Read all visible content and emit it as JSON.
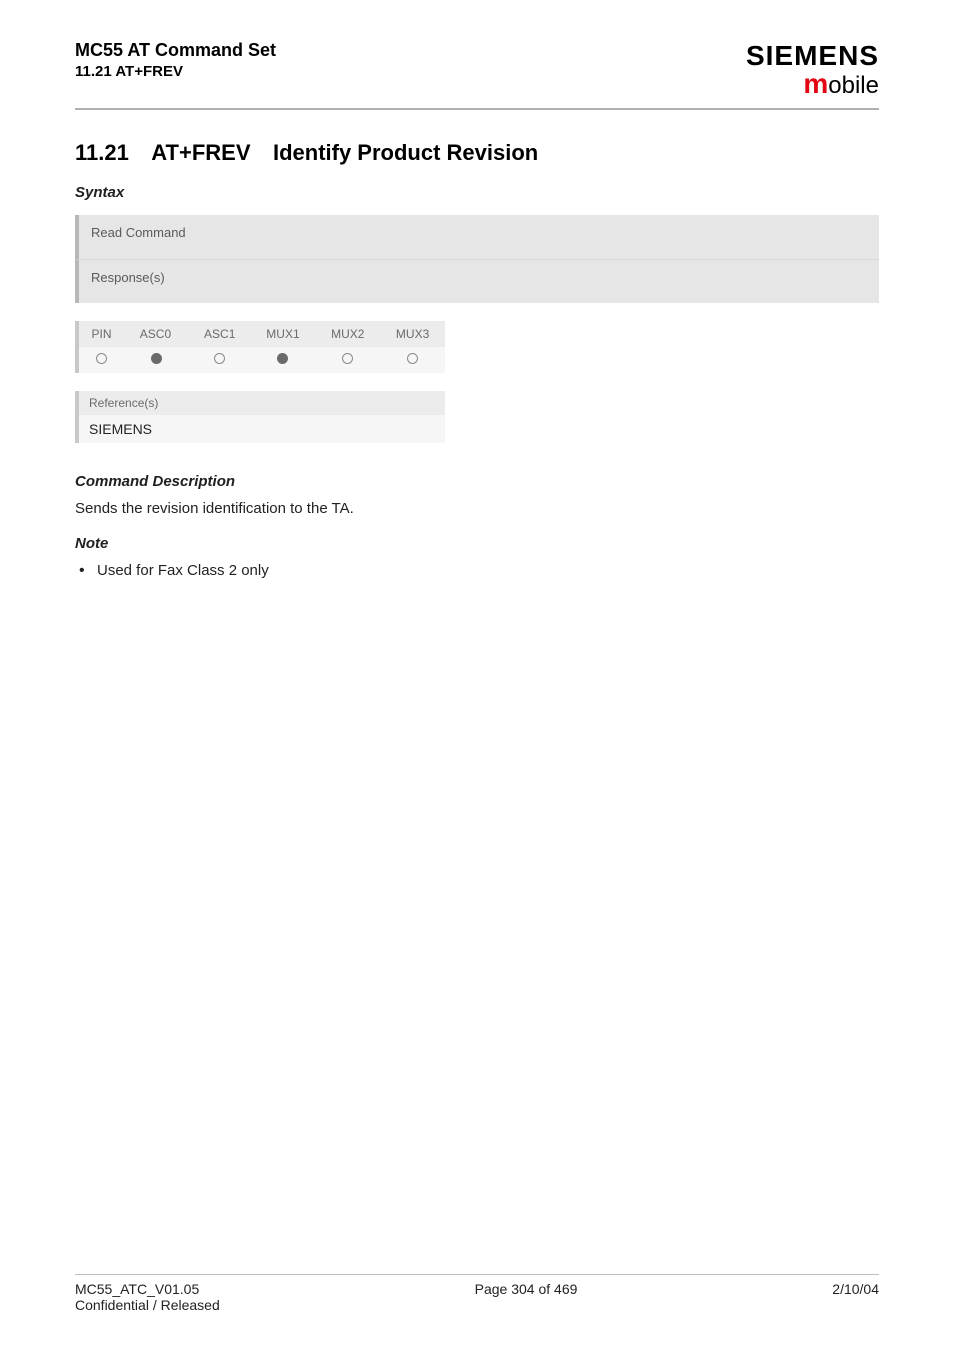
{
  "header": {
    "title": "MC55 AT Command Set",
    "subtitle": "11.21 AT+FREV",
    "logo_top": "SIEMENS",
    "logo_bottom_m": "m",
    "logo_bottom_rest": "obile"
  },
  "section": {
    "number": "11.21",
    "command": "AT+FREV",
    "title": "Identify Product Revision"
  },
  "labels": {
    "syntax": "Syntax",
    "read_command": "Read Command",
    "responses": "Response(s)",
    "reference": "Reference(s)",
    "command_description": "Command Description",
    "note": "Note"
  },
  "support_table": {
    "cols": [
      "PIN",
      "ASC0",
      "ASC1",
      "MUX1",
      "MUX2",
      "MUX3"
    ],
    "vals": [
      "empty",
      "full",
      "empty",
      "full",
      "empty",
      "empty"
    ]
  },
  "reference_value": "SIEMENS",
  "desc_text": "Sends the revision identification to the TA.",
  "notes": [
    "Used for Fax Class 2 only"
  ],
  "footer": {
    "version": "MC55_ATC_V01.05",
    "confidential": "Confidential / Released",
    "page": "Page 304 of 469",
    "date": "2/10/04"
  }
}
